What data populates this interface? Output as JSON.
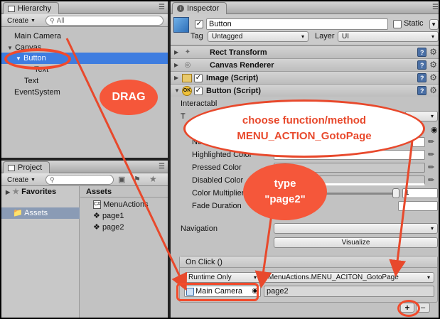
{
  "hierarchy": {
    "tab_label": "Hierarchy",
    "create_label": "Create",
    "search_placeholder": "All",
    "items": [
      {
        "label": "Main Camera"
      },
      {
        "label": "Canvas"
      },
      {
        "label": "Button"
      },
      {
        "label": "Text"
      },
      {
        "label": "Text"
      },
      {
        "label": "EventSystem"
      }
    ]
  },
  "project": {
    "tab_label": "Project",
    "create_label": "Create",
    "favorites_label": "Favorites",
    "assets_label": "Assets",
    "assets_header": "Assets",
    "files": [
      {
        "name": "MenuActions",
        "icon": "csharp-script-icon"
      },
      {
        "name": "page1",
        "icon": "unity-scene-icon"
      },
      {
        "name": "page2",
        "icon": "unity-scene-icon"
      }
    ]
  },
  "inspector": {
    "tab_label": "Inspector",
    "object_name": "Button",
    "static_label": "Static",
    "tag_label": "Tag",
    "tag_value": "Untagged",
    "layer_label": "Layer",
    "layer_value": "UI",
    "components": {
      "rect_transform": "Rect Transform",
      "canvas_renderer": "Canvas Renderer",
      "image": "Image (Script)",
      "button": "Button (Script)"
    },
    "props": {
      "interactable": "Interactabl",
      "t_label": "T",
      "normal": "Nor",
      "highlighted": "Highlighted Color",
      "pressed": "Pressed Color",
      "disabled": "Disabled Color",
      "multiplier": "Color Multiplier",
      "multiplier_value": "1",
      "fade": "Fade Duration",
      "navigation": "Navigation",
      "visualize": "Visualize"
    },
    "onclick": {
      "header": "On Click ()",
      "runtime": "Runtime Only",
      "function": "MenuActions.MENU_ACITON_GotoPage",
      "target": "Main Camera",
      "argument": "page2",
      "add": "+",
      "remove": "–"
    }
  },
  "annotations": {
    "drag": "DRAG",
    "choose_line1": "choose function/method",
    "choose_line2": "MENU_ACTION_GotoPage",
    "type_line1": "type",
    "type_line2": "\"page2\""
  },
  "colors": {
    "panel_bg": "#c2c2c2",
    "selection": "#3e7de0",
    "annotation_red": "#e8492c"
  }
}
